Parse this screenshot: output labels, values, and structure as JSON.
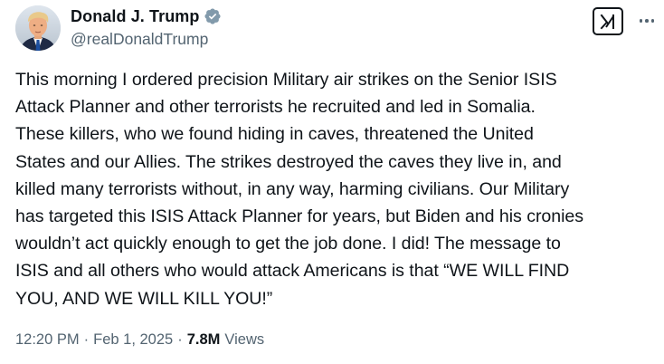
{
  "author": {
    "display_name": "Donald J. Trump",
    "handle": "@realDonaldTrump",
    "verified_icon": "verified-badge-icon",
    "verified_color": "#829aab"
  },
  "actions": {
    "grok_icon": "grok-icon",
    "more_icon": "more-options-icon"
  },
  "tweet": {
    "text": "This morning I ordered precision Military air strikes on the Senior ISIS\nAttack Planner and other terrorists he recruited and led in Somalia.\nThese killers, who we found hiding in caves, threatened the United\nStates and our Allies. The strikes destroyed the caves they live in, and\nkilled many terrorists without, in any way, harming civilians. Our Military\nhas targeted this ISIS Attack Planner for years, but Biden and his cronies\nwouldn’t act quickly enough to get the job done. I did! The message to\nISIS and all others who would attack Americans is that “WE WILL FIND\nYOU, AND WE WILL KILL YOU!”"
  },
  "meta": {
    "time": "12:20 PM",
    "separator": "·",
    "date": "Feb 1, 2025",
    "views_count": "7.8M",
    "views_label": "Views"
  },
  "colors": {
    "text_primary": "#0f1419",
    "text_secondary": "#536471",
    "background": "#ffffff"
  }
}
